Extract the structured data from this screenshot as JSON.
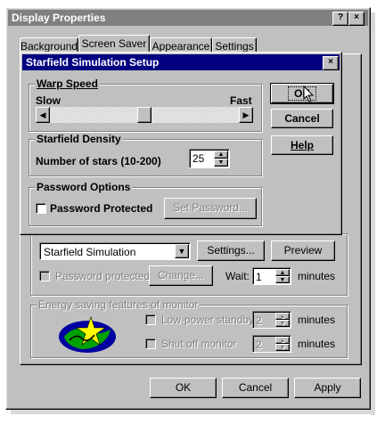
{
  "main_window": {
    "title": "Display Properties",
    "help_btn": "?",
    "close_btn": "×",
    "tabs": [
      "Background",
      "Screen Saver",
      "Appearance",
      "Settings"
    ],
    "screensaver_select": "Starfield Simulation",
    "settings_btn": "Settings...",
    "preview_btn": "Preview",
    "password_protected": "Password protected",
    "change_btn": "Change...",
    "wait_label": "Wait:",
    "wait_value": "1",
    "minutes": "minutes",
    "energy_title": "Energy saving features of monitor",
    "low_power": "Low-power standby",
    "low_power_value": "2",
    "shut_off": "Shut off monitor",
    "shut_off_value": "2",
    "ok": "OK",
    "cancel": "Cancel",
    "apply": "Apply"
  },
  "setup_dialog": {
    "title": "Starfield Simulation Setup",
    "close_btn": "×",
    "warp_title": "Warp Speed",
    "slow": "Slow",
    "fast": "Fast",
    "warp_level_fraction": 0.5,
    "density_title": "Starfield Density",
    "stars_label": "Number of stars (10-200)",
    "stars_value": "25",
    "password_title": "Password Options",
    "password_protected": "Password Protected",
    "set_password_btn": "Set Password...",
    "ok": "OK",
    "cancel": "Cancel",
    "help": "Help"
  },
  "colors": {
    "title_active": "#000080",
    "title_inactive": "#808080",
    "face": "#c0c0c0"
  }
}
